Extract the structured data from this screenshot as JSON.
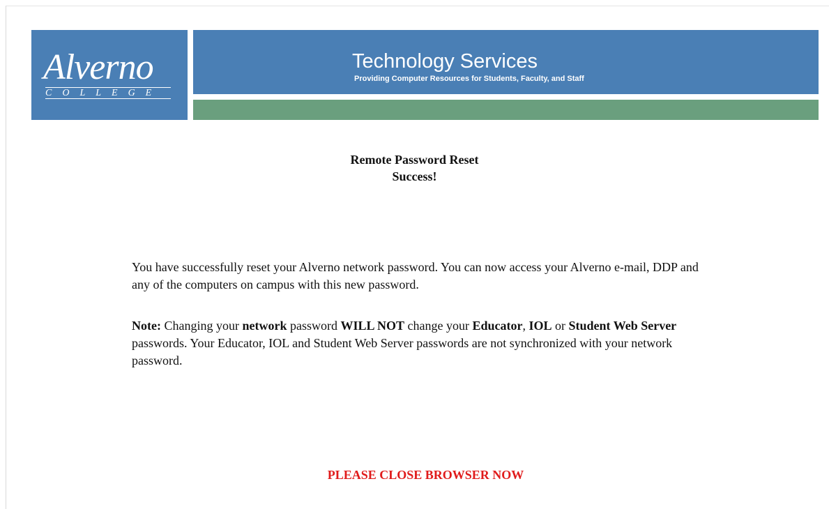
{
  "header": {
    "logo_word": "Alverno",
    "logo_sub": "COLLEGE",
    "title": "Technology Services",
    "subtitle": "Providing Computer Resources for Students, Faculty, and Staff"
  },
  "main": {
    "heading": "Remote Password Reset",
    "status": "Success!",
    "paragraph1": "You have successfully reset your Alverno network password. You can now access your Alverno e-mail, DDP and any of the computers on campus with this new password.",
    "note": {
      "label": "Note:",
      "t1": " Changing your ",
      "b1": "network",
      "t2": " password ",
      "b2": "WILL NOT",
      "t3": " change your ",
      "b3": "Educator",
      "t4": ", ",
      "b4": "IOL",
      "t5": " or ",
      "b5": "Student Web Server",
      "t6": " passwords. Your Educator, IOL and Student Web Server passwords are not synchronized with your network password."
    },
    "close_message": "PLEASE CLOSE BROWSER NOW"
  },
  "colors": {
    "banner_blue": "#4a7fb5",
    "banner_green": "#6a9f7e",
    "alert_red": "#e01b1b"
  }
}
